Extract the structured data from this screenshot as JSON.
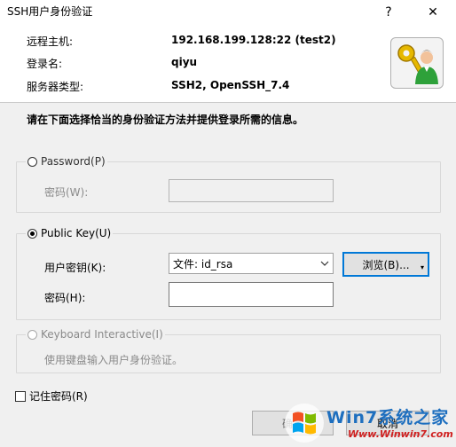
{
  "window": {
    "title": "SSH用户身份验证",
    "help_glyph": "?",
    "close_glyph": "✕"
  },
  "info": {
    "host_label": "远程主机:",
    "host_value": "192.168.199.128:22 (test2)",
    "login_label": "登录名:",
    "login_value": "qiyu",
    "server_label": "服务器类型:",
    "server_value": "SSH2, OpenSSH_7.4"
  },
  "instruction": "请在下面选择恰当的身份验证方法并提供登录所需的信息。",
  "password_group": {
    "legend": "Password(P)",
    "field_label": "密码(W):"
  },
  "pubkey_group": {
    "legend": "Public Key(U)",
    "key_label": "用户密钥(K):",
    "key_select_value": "文件: id_rsa",
    "browse_label": "浏览(B)...",
    "pass_label": "密码(H):"
  },
  "keyboard_group": {
    "legend": "Keyboard Interactive(I)",
    "desc": "使用键盘输入用户身份验证。"
  },
  "remember_label": "记住密码(R)",
  "ok_label": "确定",
  "cancel_label": "取消",
  "watermark": {
    "line1": "Win7系统之家",
    "line2": "Www.Winwin7.com"
  },
  "icons": {
    "avatar": "key-user-icon",
    "dropdown": "chevron-down-icon",
    "split": "caret-down-icon"
  }
}
